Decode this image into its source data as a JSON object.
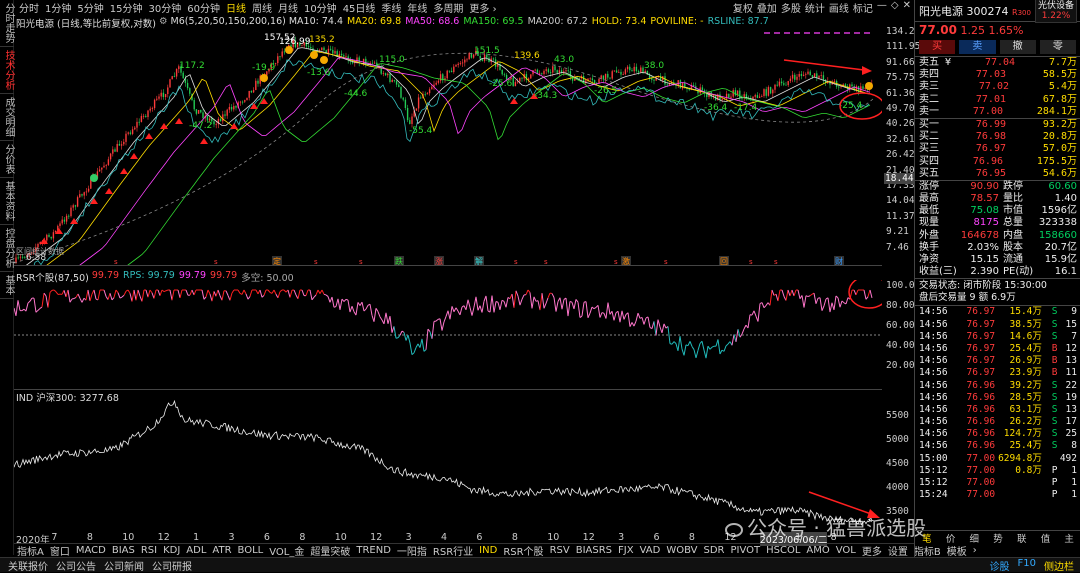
{
  "left_tabs": [
    "分时走势",
    "技术分析",
    "成交明细",
    "分价表",
    "基本资料",
    "控盘分析",
    "基本"
  ],
  "left_active": 1,
  "periods": [
    "分时",
    "1分钟",
    "5分钟",
    "15分钟",
    "30分钟",
    "60分钟",
    "日线",
    "周线",
    "月线",
    "10分钟",
    "45日线",
    "季线",
    "年线",
    "多周期",
    "更多 ›"
  ],
  "period_active": 6,
  "toolbar": [
    "复权",
    "叠加",
    "多股",
    "统计",
    "画线",
    "标记",
    "—",
    "◇",
    "✕"
  ],
  "main_legend": {
    "title": "阳光电源 (日线,等比前复权,对数)",
    "gear": "⚙",
    "m6": "M6(5,20,50,150,200,16)",
    "items": [
      {
        "t": "MA10: 74.4",
        "c": "#dddddd"
      },
      {
        "t": "MA20: 69.8",
        "c": "#ffdd00"
      },
      {
        "t": "MA50: 68.6",
        "c": "#ff44ff"
      },
      {
        "t": "MA150: 69.5",
        "c": "#33dd33"
      },
      {
        "t": "MA200: 67.2",
        "c": "#cccccc"
      },
      {
        "t": "HOLD: 73.4",
        "c": "#ffdd00"
      },
      {
        "t": "POVILINE: -",
        "c": "#ffdd00"
      },
      {
        "t": "RSLINE: 87.7",
        "c": "#33bbbb"
      }
    ]
  },
  "price_axis": [
    "134.2",
    "111.95",
    "91.66",
    "75.75",
    "61.36",
    "49.70",
    "40.26",
    "32.61",
    "26.42",
    "21.40",
    "17.33",
    "14.04",
    "11.37",
    "9.21",
    "7.46"
  ],
  "price_tag": "18.44",
  "price_annotations": [
    {
      "t": "157.52",
      "c": "#ffffff"
    },
    {
      "t": "126.99",
      "c": "#ffffff"
    },
    {
      "t": "135.2",
      "c": "#ffdd00"
    },
    {
      "t": "117.2",
      "c": "#33dd33"
    },
    {
      "t": "151.5",
      "c": "#33dd33"
    },
    {
      "t": "139.6",
      "c": "#ffdd00"
    },
    {
      "t": "115.0",
      "c": "#33dd33"
    },
    {
      "t": "43.0",
      "c": "#33dd33"
    },
    {
      "t": "38.0",
      "c": "#33dd33"
    },
    {
      "t": "-44.6",
      "c": "#33dd33"
    },
    {
      "t": "-25.6",
      "c": "#33dd33"
    },
    {
      "t": "-34.3",
      "c": "#33dd33"
    },
    {
      "t": "-26.5",
      "c": "#33dd33"
    },
    {
      "t": "-55.4",
      "c": "#33dd33"
    },
    {
      "t": "-36.4",
      "c": "#33dd33"
    },
    {
      "t": "-17.4",
      "c": "#33dd33"
    },
    {
      "t": "-19.9",
      "c": "#33dd33"
    },
    {
      "t": "-13.6",
      "c": "#33dd33"
    },
    {
      "t": "-47.2",
      "c": "#33dd33"
    },
    {
      "t": "-25.4",
      "c": "#33dd33"
    }
  ],
  "low_label": "6.58",
  "bottom_left_note": "区间统计数据",
  "event_markers": [
    {
      "t": "定",
      "c": "#ff8800"
    },
    {
      "t": "跌",
      "c": "#33dd33"
    },
    {
      "t": "涨",
      "c": "#ff3b3b"
    },
    {
      "t": "解",
      "c": "#33cccc"
    },
    {
      "t": "激",
      "c": "#ff8800"
    },
    {
      "t": "回",
      "c": "#ff8800"
    },
    {
      "t": "财",
      "c": "#3399ff"
    }
  ],
  "rsr_legend": {
    "name": "RSR个股(87,50)",
    "items": [
      {
        "t": "99.79",
        "c": "#ff3b3b"
      },
      {
        "t": "RPS: 99.79",
        "c": "#33bbbb"
      },
      {
        "t": "99.79",
        "c": "#ff44ff"
      },
      {
        "t": "99.79",
        "c": "#ff3b3b"
      },
      {
        "t": "多空: 50.00",
        "c": "#aaaaaa"
      }
    ]
  },
  "rsr_axis": [
    "100.0",
    "80.00",
    "60.00",
    "40.00",
    "20.00"
  ],
  "ind_legend": {
    "name": "IND 沪深300: 3277.68"
  },
  "ind_axis": [
    "5500",
    "5000",
    "4500",
    "4000",
    "3500"
  ],
  "time_axis": [
    "2020年",
    "7",
    "8",
    "10",
    "12",
    "1",
    "3",
    "6",
    "8",
    "10",
    "12",
    "3",
    "4",
    "6",
    "8",
    "10",
    "12",
    "3",
    "6",
    "8",
    "12",
    "2023/06/06/二",
    "1",
    "8"
  ],
  "watermark": "公众号 · 猛兽派选股",
  "bottom_tabs": [
    "指标A",
    "窗口",
    "MACD",
    "BIAS",
    "RSI",
    "KDJ",
    "ADL",
    "ATR",
    "BOLL",
    "VOL_金",
    "超量突破",
    "TREND",
    "一阳指",
    "RSR行业",
    "IND",
    "RSR个股",
    "RSV",
    "BIASRS",
    "FJX",
    "VAD",
    "WOBV",
    "SDR",
    "PIVOT",
    "HSCOL",
    "AMO",
    "VOL",
    "更多",
    "设置",
    "指标B",
    "模板",
    "›"
  ],
  "bottom_tab_active": 14,
  "status_bar": [
    "关联报价",
    "公司公告",
    "公司新闻",
    "公司研报"
  ],
  "status_right": [
    "诊股",
    "F10",
    "侧边栏"
  ],
  "stock": {
    "name": "阳光电源",
    "code": "300274",
    "flag": "R",
    "flag2": "300",
    "sector": "光伏设备",
    "sector_chg": "1.22%",
    "price": "77.00",
    "change": "1.25",
    "pct": "1.65%"
  },
  "trade_buttons": [
    "买",
    "卖",
    "撤",
    "零"
  ],
  "asks": [
    {
      "l": "卖五 ¥",
      "p": "77.04",
      "v": "7.7万"
    },
    {
      "l": "卖四",
      "p": "77.03",
      "v": "58.5万"
    },
    {
      "l": "卖三",
      "p": "77.02",
      "v": "5.4万"
    },
    {
      "l": "卖二",
      "p": "77.01",
      "v": "67.8万"
    },
    {
      "l": "卖一",
      "p": "77.00",
      "v": "284.1万"
    }
  ],
  "bids": [
    {
      "l": "买一",
      "p": "76.99",
      "v": "93.2万"
    },
    {
      "l": "买二",
      "p": "76.98",
      "v": "20.8万"
    },
    {
      "l": "买三",
      "p": "76.97",
      "v": "57.0万"
    },
    {
      "l": "买四",
      "p": "76.96",
      "v": "175.5万"
    },
    {
      "l": "买五",
      "p": "76.95",
      "v": "54.6万"
    }
  ],
  "stats": [
    {
      "a": "涨停",
      "av": "90.90",
      "ac": "red",
      "b": "跌停",
      "bv": "60.60",
      "bc": "green"
    },
    {
      "a": "最高",
      "av": "78.57",
      "ac": "red",
      "b": "量比",
      "bv": "1.40",
      "bc": "white"
    },
    {
      "a": "最低",
      "av": "75.08",
      "ac": "green",
      "b": "市值",
      "bv": "1596亿",
      "bc": "white"
    },
    {
      "a": "现量",
      "av": "8175",
      "ac": "mag",
      "b": "总量",
      "bv": "323338",
      "bc": "white"
    },
    {
      "a": "外盘",
      "av": "164678",
      "ac": "red",
      "b": "内盘",
      "bv": "158660",
      "bc": "green"
    },
    {
      "a": "换手",
      "av": "2.03%",
      "ac": "white",
      "b": "股本",
      "bv": "20.7亿",
      "bc": "white"
    },
    {
      "a": "净资",
      "av": "15.15",
      "ac": "white",
      "b": "流通",
      "bv": "15.9亿",
      "bc": "white"
    },
    {
      "a": "收益(三)",
      "av": "2.390",
      "ac": "white",
      "b": "PE(动)",
      "bv": "16.1",
      "bc": "white"
    }
  ],
  "trade_status": "交易状态: 闭市阶段 15:30:00",
  "after_hours": "盘后交易量 9 额 6.9万",
  "ticks": [
    {
      "t": "14:56",
      "p": "76.97",
      "v": "15.4万",
      "s": "S",
      "n": "9"
    },
    {
      "t": "14:56",
      "p": "76.97",
      "v": "38.5万",
      "s": "S",
      "n": "15"
    },
    {
      "t": "14:56",
      "p": "76.97",
      "v": "14.6万",
      "s": "S",
      "n": "7"
    },
    {
      "t": "14:56",
      "p": "76.97",
      "v": "25.4万",
      "s": "B",
      "n": "12"
    },
    {
      "t": "14:56",
      "p": "76.97",
      "v": "26.9万",
      "s": "B",
      "n": "13"
    },
    {
      "t": "14:56",
      "p": "76.97",
      "v": "23.9万",
      "s": "B",
      "n": "11"
    },
    {
      "t": "14:56",
      "p": "76.96",
      "v": "39.2万",
      "s": "S",
      "n": "22"
    },
    {
      "t": "14:56",
      "p": "76.96",
      "v": "28.5万",
      "s": "S",
      "n": "19"
    },
    {
      "t": "14:56",
      "p": "76.96",
      "v": "63.1万",
      "s": "S",
      "n": "13"
    },
    {
      "t": "14:56",
      "p": "76.96",
      "v": "26.2万",
      "s": "S",
      "n": "17"
    },
    {
      "t": "14:56",
      "p": "76.96",
      "v": "124.7万",
      "s": "S",
      "n": "25"
    },
    {
      "t": "14:56",
      "p": "76.96",
      "v": "25.4万",
      "s": "S",
      "n": "8"
    },
    {
      "t": "15:00",
      "p": "77.00",
      "v": "6294.8万",
      "s": "",
      "n": "492"
    },
    {
      "t": "15:12",
      "p": "77.00",
      "v": "0.8万",
      "s": "P",
      "n": "1"
    },
    {
      "t": "15:12",
      "p": "77.00",
      "v": "",
      "s": "P",
      "n": "1"
    },
    {
      "t": "15:24",
      "p": "77.00",
      "v": "",
      "s": "P",
      "n": "1"
    }
  ],
  "right_bottom_tabs": [
    "笔",
    "价",
    "细",
    "势",
    "联",
    "值",
    "主"
  ]
}
